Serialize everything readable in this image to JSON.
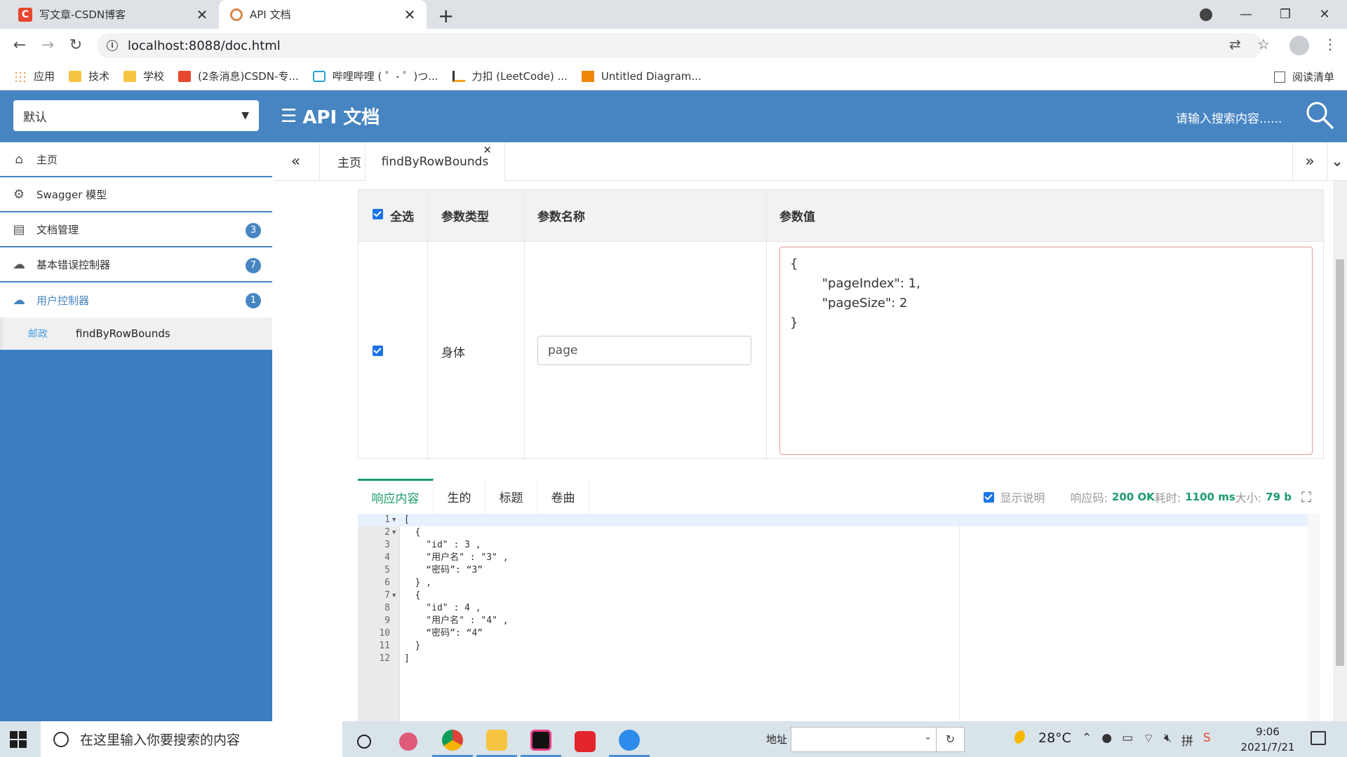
{
  "browser": {
    "tabs": [
      {
        "title": "写文章-CSDN博客",
        "favicon": "csdn-logo-icon"
      },
      {
        "title": "API 文档",
        "favicon": "swagger-logo-icon"
      }
    ],
    "url": "localhost:8088/doc.html",
    "bookmarks": [
      {
        "label": "应用",
        "icon": "apps-grid-icon"
      },
      {
        "label": "技术",
        "icon": "folder-icon"
      },
      {
        "label": "学校",
        "icon": "folder-icon"
      },
      {
        "label": "(2条消息)CSDN-专...",
        "icon": "csdn-logo-icon"
      },
      {
        "label": "哔哩哔哩 ( ゜- ゜)つ...",
        "icon": "bilibili-icon"
      },
      {
        "label": "力扣 (LeetCode) ...",
        "icon": "leetcode-icon"
      },
      {
        "label": "Untitled Diagram...",
        "icon": "diagram-icon"
      }
    ],
    "reading_list": "阅读清单"
  },
  "header": {
    "group_select": "默认",
    "title": "API 文档",
    "search_placeholder": "请输入搜索内容......"
  },
  "sidebar": {
    "items": [
      {
        "label": "主页",
        "icon": "home-icon",
        "badge": ""
      },
      {
        "label": "Swagger 模型",
        "icon": "model-icon",
        "badge": ""
      },
      {
        "label": "文档管理",
        "icon": "document-icon",
        "badge": "3"
      },
      {
        "label": "基本错误控制器",
        "icon": "api-cloud-icon",
        "badge": "7"
      },
      {
        "label": "用户控制器",
        "icon": "api-cloud-icon",
        "badge": "1"
      }
    ],
    "subitem": {
      "method": "邮政",
      "label": "findByRowBounds"
    }
  },
  "content_tabs": [
    {
      "label": "主页"
    },
    {
      "label": "findByRowBounds"
    }
  ],
  "params": {
    "headers": {
      "select_all": "全选",
      "type": "参数类型",
      "name": "参数名称",
      "value": "参数值"
    },
    "row": {
      "type": "身体",
      "name": "page",
      "value": "{\n        \"pageIndex\": 1,\n        \"pageSize\": 2\n}"
    }
  },
  "response": {
    "tabs": [
      "响应内容",
      "生的",
      "标题",
      "卷曲"
    ],
    "show_desc": "显示说明",
    "code_label": "响应码:",
    "code_value": "200 OK",
    "time_label": "耗时:",
    "time_value": "1100 ms",
    "size_label": "大小:",
    "size_value": "79 b",
    "lines": [
      {
        "n": "1",
        "fold": true,
        "text": "["
      },
      {
        "n": "2",
        "fold": true,
        "text": "  {"
      },
      {
        "n": "3",
        "fold": false,
        "text": "    \"id\" : 3 ,"
      },
      {
        "n": "4",
        "fold": false,
        "text": "    \"用户名\" : \"3\" ,"
      },
      {
        "n": "5",
        "fold": false,
        "text": "    “密码”: “3”"
      },
      {
        "n": "6",
        "fold": false,
        "text": "  } ,"
      },
      {
        "n": "7",
        "fold": true,
        "text": "  {"
      },
      {
        "n": "8",
        "fold": false,
        "text": "    \"id\" : 4 ,"
      },
      {
        "n": "9",
        "fold": false,
        "text": "    \"用户名\" : \"4\" ,"
      },
      {
        "n": "10",
        "fold": false,
        "text": "    “密码”: “4”"
      },
      {
        "n": "11",
        "fold": false,
        "text": "  }"
      },
      {
        "n": "12",
        "fold": false,
        "text": "]"
      }
    ]
  },
  "taskbar": {
    "search_placeholder": "在这里输入你要搜索的内容",
    "address_label": "地址",
    "weather": "28°C",
    "time": "9:06",
    "date": "2021/7/21"
  },
  "colors": {
    "header_blue": "#4785c2",
    "sidebar_blue": "#3b7dbf",
    "accent_green": "#1c9c6a"
  }
}
